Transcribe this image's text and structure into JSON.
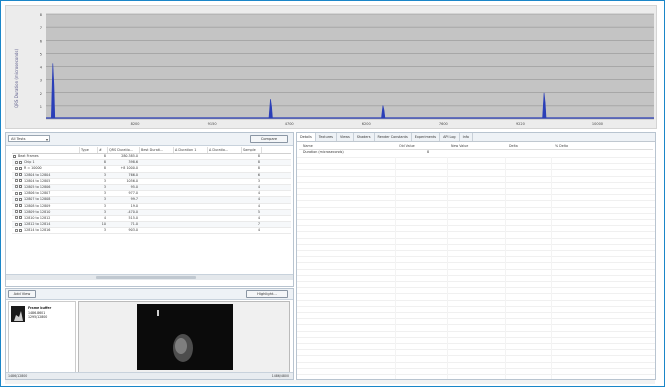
{
  "chart": {
    "ylabel": "QRS Duration (microseconds)",
    "xticks": [
      "8200",
      "9150",
      "4700",
      "6200",
      "7600",
      "9220",
      "10000"
    ],
    "yticks": [
      "8",
      "7",
      "6",
      "5",
      "4",
      "3",
      "2",
      "1"
    ],
    "chart_data": {
      "type": "line",
      "ylabel": "QRS Duration (microseconds)",
      "xticks": [
        "8200",
        "9150",
        "4700",
        "6200",
        "7600",
        "9220",
        "10000"
      ],
      "spikes_x_fraction": [
        0.012,
        0.37,
        0.555,
        0.82
      ],
      "spikes_height": [
        0.52,
        0.18,
        0.12,
        0.24
      ],
      "grid": true
    },
    "colors": {
      "plot_bg": "#c4c4c4",
      "line": "#2b3fb8",
      "frame": "#1a86c8"
    }
  },
  "left": {
    "select_value": "All Tests",
    "compare_label": "Compare",
    "columns": [
      "",
      "Type",
      "#",
      "QRS Duratio...",
      "Best Durati...",
      "Δ Duration 1",
      "Δ Duratio...",
      "Sample"
    ],
    "rows": [
      {
        "label": "Beat Frames",
        "type": "",
        "n": "8",
        "v1": "280.385.0",
        "v2": "",
        "v3": "",
        "v4": "",
        "s": "8"
      },
      {
        "label": "Chip 1",
        "type": "",
        "n": "8",
        "v1": "398.6",
        "v2": "",
        "v3": "",
        "v4": "",
        "s": "8"
      },
      {
        "label": "R = 10000",
        "type": "",
        "n": "8",
        "v1": "+8 1000.0",
        "v2": "",
        "v3": "",
        "v4": "",
        "s": "8"
      },
      {
        "label": "12804 to 12804",
        "type": "",
        "n": "3",
        "v1": "766.0",
        "v2": "",
        "v3": "",
        "v4": "",
        "s": "6"
      },
      {
        "label": "12804 to 12805",
        "type": "",
        "n": "3",
        "v1": "1056.0",
        "v2": "",
        "v3": "",
        "v4": "",
        "s": "3"
      },
      {
        "label": "12805 to 12806",
        "type": "",
        "n": "3",
        "v1": "95.0",
        "v2": "",
        "v3": "",
        "v4": "",
        "s": "4"
      },
      {
        "label": "12806 to 12807",
        "type": "",
        "n": "3",
        "v1": "977.0",
        "v2": "",
        "v3": "",
        "v4": "",
        "s": "4"
      },
      {
        "label": "12807 to 12808",
        "type": "",
        "n": "3",
        "v1": "99.7",
        "v2": "",
        "v3": "",
        "v4": "",
        "s": "4"
      },
      {
        "label": "12808 to 12809",
        "type": "",
        "n": "3",
        "v1": "19.0",
        "v2": "",
        "v3": "",
        "v4": "",
        "s": "4"
      },
      {
        "label": "12809 to 12810",
        "type": "",
        "n": "3",
        "v1": "-470.0",
        "v2": "",
        "v3": "",
        "v4": "",
        "s": "5"
      },
      {
        "label": "12810 to 12812",
        "type": "",
        "n": "4",
        "v1": "515.0",
        "v2": "",
        "v3": "",
        "v4": "",
        "s": "4"
      },
      {
        "label": "12812 to 12814",
        "type": "",
        "n": "10",
        "v1": "71.0",
        "v2": "",
        "v3": "",
        "v4": "",
        "s": "7"
      },
      {
        "label": "12814 to 12816",
        "type": "",
        "n": "3",
        "v1": "903.0",
        "v2": "",
        "v3": "",
        "v4": "",
        "s": "4"
      }
    ]
  },
  "bottom": {
    "add_view_label": "Add View",
    "highlight_label": "Highlight...",
    "thumb_title": "Frame buffer",
    "thumb_line1": "1486.8601",
    "thumb_line2": "1295/12800",
    "status_left": "1486/12800",
    "status_right": "1486/4800"
  },
  "right": {
    "tabs": [
      "Details",
      "Textures",
      "Views",
      "Shaders",
      "Render Constants",
      "Experiments",
      "API Log",
      "Info"
    ],
    "columns": [
      "Name",
      "Old Value",
      "New Value",
      "Delta",
      "% Delta"
    ],
    "row": {
      "name": "Duration (microseconds)",
      "old": "8",
      "new": "",
      "delta": "",
      "pct": ""
    }
  }
}
